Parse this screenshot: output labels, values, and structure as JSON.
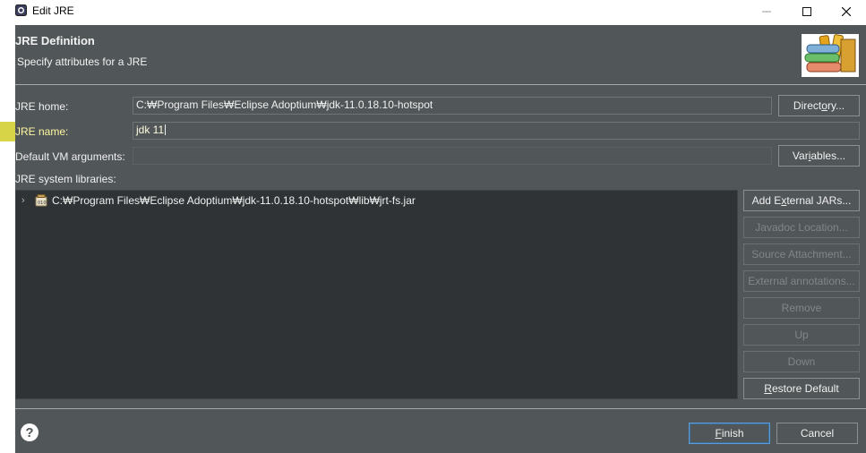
{
  "window": {
    "title": "Edit JRE"
  },
  "header": {
    "title": "JRE Definition",
    "subtitle": "Specify attributes for a JRE"
  },
  "form": {
    "jre_home": {
      "label": "JRE home:",
      "value": "C:₩Program Files₩Eclipse Adoptium₩jdk-11.0.18.10-hotspot"
    },
    "jre_name": {
      "label": "JRE name:",
      "value": "jdk 11"
    },
    "vm_args": {
      "label": "Default VM arguments:",
      "value": ""
    },
    "directory_button": {
      "before": "Direct",
      "mnemonic": "o",
      "after": "ry..."
    },
    "variables_button": {
      "before": "Var",
      "mnemonic": "i",
      "after": "ables..."
    }
  },
  "libraries": {
    "label": "JRE system libraries:",
    "items": [
      {
        "path": "C:₩Program Files₩Eclipse Adoptium₩jdk-11.0.18.10-hotspot₩lib₩jrt-fs.jar"
      }
    ]
  },
  "side_buttons": {
    "add_external": {
      "before": "Add E",
      "mnemonic": "x",
      "after": "ternal JARs...",
      "enabled": true
    },
    "javadoc": {
      "label": "Javadoc Location...",
      "enabled": false
    },
    "source": {
      "label": "Source Attachment...",
      "enabled": false
    },
    "annotations": {
      "label": "External annotations...",
      "enabled": false
    },
    "remove": {
      "label": "Remove",
      "enabled": false
    },
    "up": {
      "label": "Up",
      "enabled": false
    },
    "down": {
      "label": "Down",
      "enabled": false
    },
    "restore": {
      "before": "",
      "mnemonic": "R",
      "after": "estore Default",
      "enabled": true
    }
  },
  "footer": {
    "finish": {
      "mnemonic": "F",
      "after": "inish"
    },
    "cancel": "Cancel"
  },
  "colors": {
    "dialog_bg": "#515658",
    "tree_bg": "#2f3335",
    "highlight": "#c9c400",
    "focus": "#5a9bd8"
  },
  "icons": [
    "app-icon",
    "minimize-icon",
    "maximize-icon",
    "close-icon",
    "books-icon",
    "chevron-right-icon",
    "jar-icon",
    "help-icon"
  ]
}
